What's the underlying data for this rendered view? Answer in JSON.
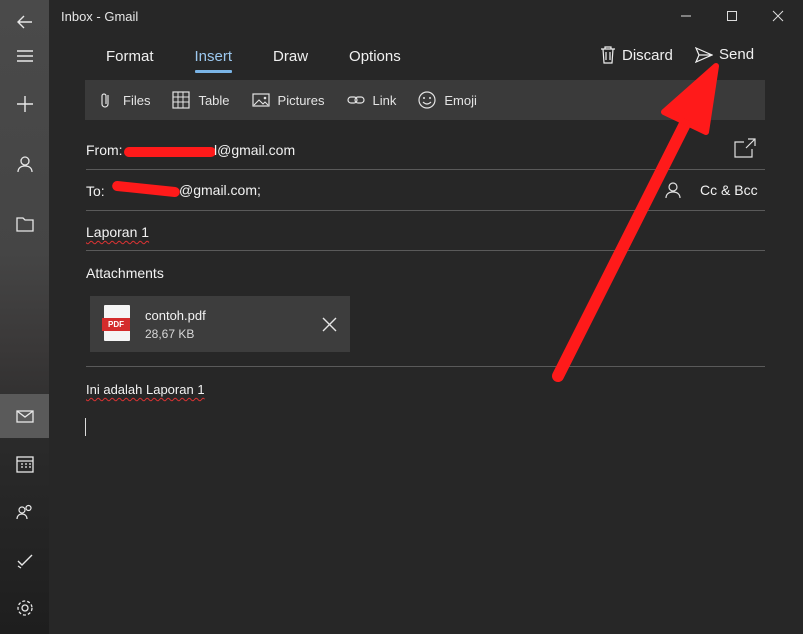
{
  "window": {
    "title": "Inbox - Gmail"
  },
  "tabs": [
    {
      "label": "Format",
      "active": false
    },
    {
      "label": "Insert",
      "active": true
    },
    {
      "label": "Draw",
      "active": false
    },
    {
      "label": "Options",
      "active": false
    }
  ],
  "actions": {
    "discard": "Discard",
    "send": "Send"
  },
  "toolbar": {
    "files": "Files",
    "table": "Table",
    "pictures": "Pictures",
    "link": "Link",
    "emoji": "Emoji"
  },
  "compose": {
    "from_label": "From:",
    "from_visible": "l@gmail.com",
    "to_label": "To:",
    "to_visible": "@gmail.com;",
    "cc_bcc": "Cc & Bcc",
    "subject": "Laporan 1",
    "attachments_label": "Attachments",
    "body": "Ini adalah Laporan 1"
  },
  "attachment": {
    "name": "contoh.pdf",
    "size": "28,67 KB",
    "badge": "PDF"
  },
  "colors": {
    "accent": "#7ab4e6",
    "annotation": "#ff1a1a",
    "background": "#272727"
  },
  "icons": [
    "back-arrow-icon",
    "hamburger-icon",
    "plus-icon",
    "person-icon",
    "folder-icon",
    "mail-icon",
    "calendar-icon",
    "people-icon",
    "todo-icon",
    "settings-icon",
    "minimize-icon",
    "maximize-icon",
    "close-icon",
    "trash-icon",
    "send-icon",
    "paperclip-icon",
    "table-icon",
    "picture-icon",
    "link-icon",
    "emoji-icon",
    "popout-icon",
    "pdf-icon"
  ]
}
